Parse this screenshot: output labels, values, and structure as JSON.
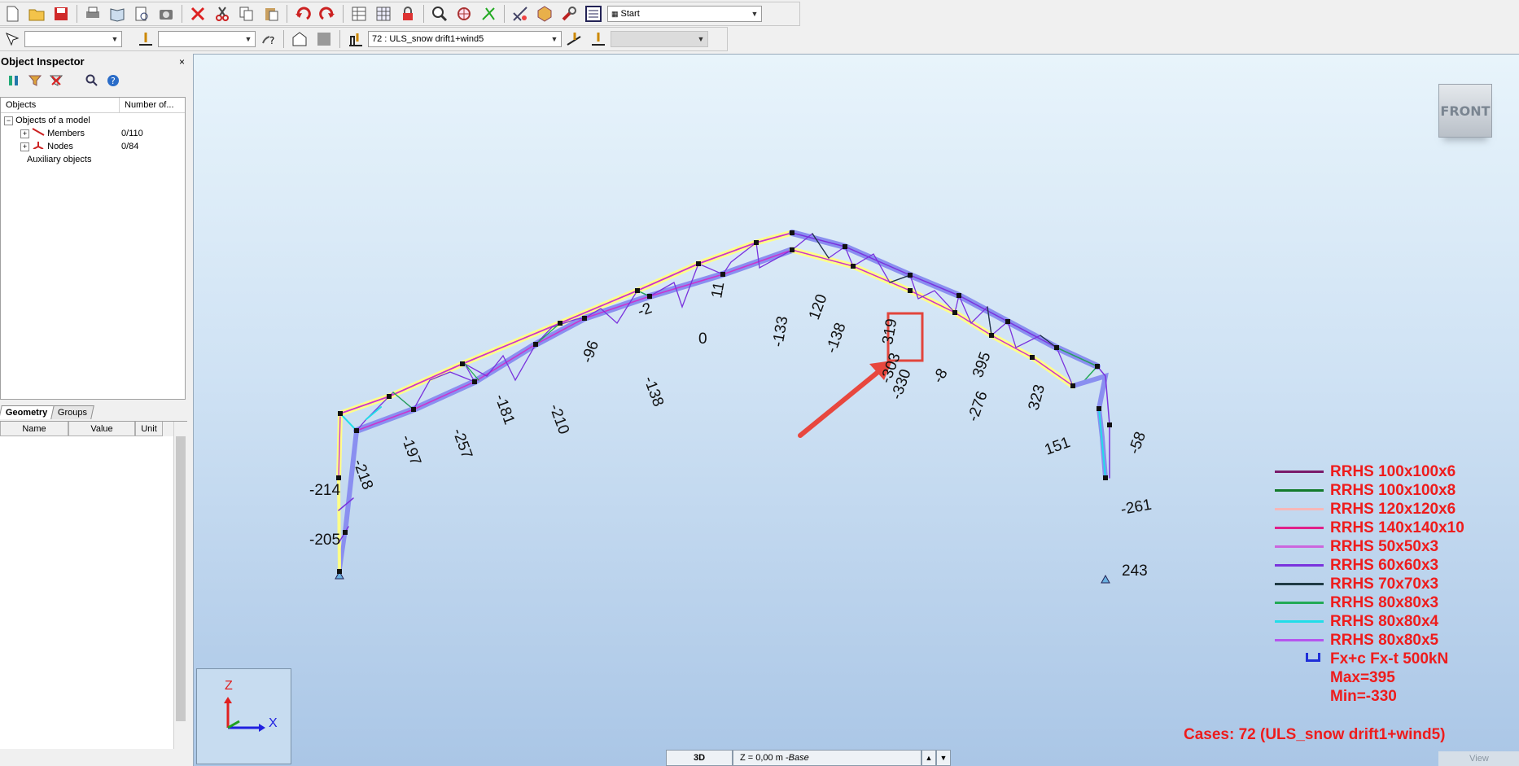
{
  "toolbar1": {
    "buttons": [
      "new-icon",
      "open-icon",
      "save-icon",
      "print-icon",
      "print-preview-icon",
      "preview-icon",
      "screen-capture-icon",
      "delete-icon",
      "cut-icon",
      "copy-icon",
      "paste-icon",
      "undo-icon",
      "redo-icon",
      "table-icon",
      "table-edit-icon",
      "lock-icon",
      "zoom-window-icon",
      "zoom-icon",
      "snap-icon",
      "structure-icon",
      "display-icon",
      "tools-icon",
      "layout-icon"
    ],
    "layout_select": "Start"
  },
  "toolbar2": {
    "selection_combo": "",
    "cases_combo": "",
    "load_case_select": "72 : ULS_snow drift1+wind5",
    "disabled_combo": ""
  },
  "inspector": {
    "title": "Object Inspector",
    "close": "×",
    "tree_columns": [
      "Objects",
      "Number of..."
    ],
    "tree": [
      {
        "label": "Objects of a model",
        "count": ""
      },
      {
        "label": "Members",
        "count": "0/110"
      },
      {
        "label": "Nodes",
        "count": "0/84"
      },
      {
        "label": "Auxiliary objects",
        "count": ""
      }
    ],
    "tabs": [
      "Geometry",
      "Groups"
    ],
    "prop_columns": [
      "Name",
      "Value",
      "Unit"
    ]
  },
  "viewport": {
    "viewcube": "FRONT",
    "axis_z": "Z",
    "axis_x": "X",
    "status_mode": "3D",
    "status_plane": "Z = 0,00 m - ",
    "status_plane_name": "Base",
    "view_tab": "View",
    "force_labels": [
      "-214",
      "-205",
      "-218",
      "-197",
      "-257",
      "-181",
      "-210",
      "-96",
      "-138",
      "-2",
      "0",
      "11",
      "-133",
      "-138",
      "120",
      "-303",
      "319",
      "-330",
      "-8",
      "395",
      "-276",
      "323",
      "151",
      "-58",
      "-261",
      "243"
    ],
    "legend": [
      {
        "label": "RRHS 100x100x6",
        "color": "#7a1a6a"
      },
      {
        "label": "RRHS 100x100x8",
        "color": "#137a2a"
      },
      {
        "label": "RRHS 120x120x6",
        "color": "#f7b7b7"
      },
      {
        "label": "RRHS 140x140x10",
        "color": "#e0208a"
      },
      {
        "label": "RRHS 50x50x3",
        "color": "#cc66dd"
      },
      {
        "label": "RRHS 60x60x3",
        "color": "#7a33dd"
      },
      {
        "label": "RRHS 70x70x3",
        "color": "#1f3a44"
      },
      {
        "label": "RRHS 80x80x3",
        "color": "#22aa55"
      },
      {
        "label": "RRHS 80x80x4",
        "color": "#22dde8"
      },
      {
        "label": "RRHS 80x80x5",
        "color": "#b655ee"
      }
    ],
    "force_legend": "Fx+c Fx-t  500kN",
    "max": "Max=395",
    "min": "Min=-330",
    "cases": "Cases: 72 (ULS_snow drift1+wind5)"
  }
}
